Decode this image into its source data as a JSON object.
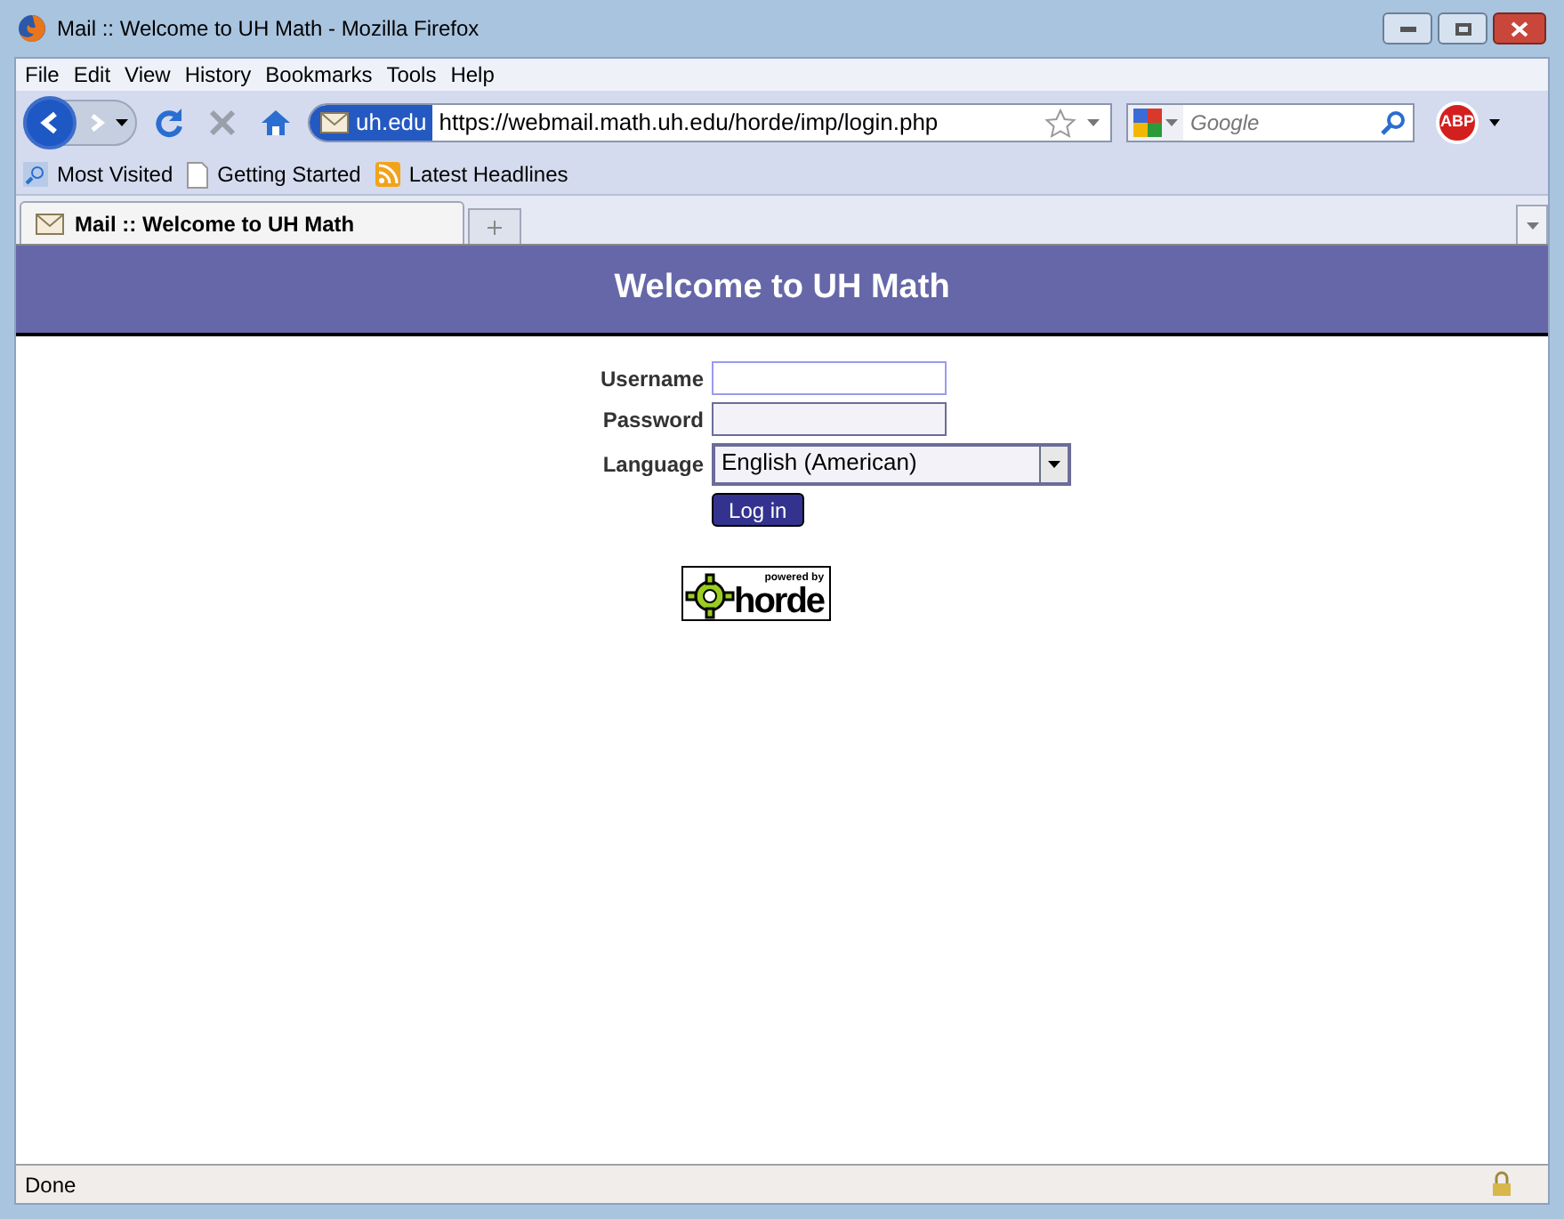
{
  "window": {
    "title": "Mail :: Welcome to UH Math - Mozilla Firefox"
  },
  "menu": [
    "File",
    "Edit",
    "View",
    "History",
    "Bookmarks",
    "Tools",
    "Help"
  ],
  "address_bar": {
    "site_badge": "uh.edu",
    "url": "https://webmail.math.uh.edu/horde/imp/login.php"
  },
  "search": {
    "placeholder": "Google"
  },
  "adblock": "ABP",
  "bookmarks": [
    "Most Visited",
    "Getting Started",
    "Latest Headlines"
  ],
  "tabs": [
    {
      "label": "Mail :: Welcome to UH Math",
      "selected": true
    }
  ],
  "page": {
    "header": "Welcome to UH Math",
    "fields": [
      {
        "label": "Username",
        "kind": "text",
        "focused": true
      },
      {
        "label": "Password",
        "kind": "password",
        "focused": false
      },
      {
        "label": "Language",
        "kind": "select",
        "value": "English (American)"
      }
    ],
    "login_button": "Log in",
    "badge": {
      "top": "powered by",
      "name": "horde"
    }
  },
  "status_bar": {
    "text": "Done"
  }
}
